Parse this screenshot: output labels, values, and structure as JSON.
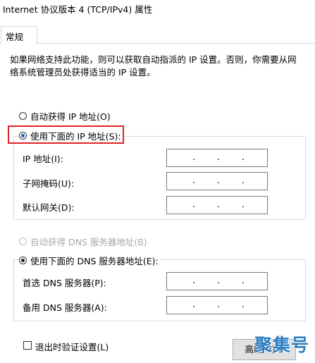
{
  "window": {
    "title": "Internet 协议版本 4 (TCP/IPv4) 属性"
  },
  "tabs": [
    {
      "label": "常规"
    }
  ],
  "description": {
    "line1": "如果网络支持此功能，则可以获取自动指派的 IP 设置。否则，你需要从网",
    "line2": "络系统管理员处获得适当的 IP 设置。"
  },
  "ip": {
    "auto_label": "自动获得 IP 地址(O)",
    "manual_label": "使用下面的 IP 地址(S):",
    "selected": "manual",
    "fields": [
      {
        "label": "IP 地址(I):",
        "value": ". . ."
      },
      {
        "label": "子网掩码(U):",
        "value": ". . ."
      },
      {
        "label": "默认网关(D):",
        "value": ". . ."
      }
    ]
  },
  "dns": {
    "auto_label": "自动获得 DNS 服务器地址(B)",
    "auto_disabled": true,
    "manual_label": "使用下面的 DNS 服务器地址(E):",
    "selected": "manual",
    "fields": [
      {
        "label": "首选 DNS 服务器(P):",
        "value": ". . ."
      },
      {
        "label": "备用 DNS 服务器(A):",
        "value": ". . ."
      }
    ]
  },
  "validate_on_exit": {
    "label": "退出时验证设置(L)",
    "checked": false
  },
  "advanced_button": {
    "label": "高级(V)..."
  },
  "watermark": {
    "text": "聚集号"
  },
  "colors": {
    "highlight": "#e02424",
    "radio_accent": "#1a5fb4",
    "watermark": "#2f7fc1"
  }
}
